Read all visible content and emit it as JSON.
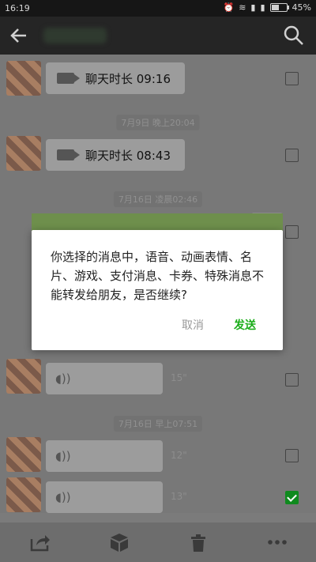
{
  "status": {
    "time": "16:19",
    "battery": "45%"
  },
  "chat": {
    "time_labels": [
      "7月9日 晚上20:04",
      "7月16日 凌晨02:46",
      "7月16日 早上07:51"
    ],
    "calls": [
      {
        "label": "聊天时长 09:16"
      },
      {
        "label": "聊天时长 08:43"
      }
    ],
    "voices": [
      {
        "duration": "15\""
      },
      {
        "duration": "12\""
      },
      {
        "duration": "13\""
      }
    ]
  },
  "dialog": {
    "message": "你选择的消息中，语音、动画表情、名片、游戏、支付消息、卡券、特殊消息不能转发给朋友，是否继续?",
    "cancel": "取消",
    "send": "发送",
    "colors": {
      "send": "#1aad19",
      "cancel": "#999999"
    }
  },
  "icons": [
    "back-arrow-icon",
    "search-icon",
    "video-call-icon",
    "voice-icon",
    "share-icon",
    "favorite-box-icon",
    "trash-icon",
    "more-icon",
    "battery-icon",
    "wifi-icon",
    "signal-icon",
    "alarm-icon"
  ]
}
